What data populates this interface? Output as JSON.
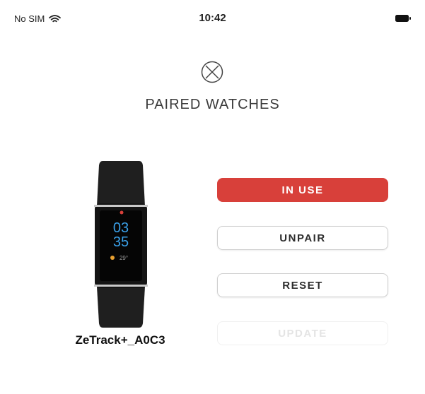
{
  "status_bar": {
    "carrier": "No SIM",
    "time": "10:42"
  },
  "header": {
    "title": "PAIRED WATCHES"
  },
  "device": {
    "name": "ZeTrack+_A0C3",
    "screen_hour": "03",
    "screen_minute": "35",
    "screen_temp": "29°"
  },
  "actions": {
    "in_use_label": "IN USE",
    "unpair_label": "UNPAIR",
    "reset_label": "RESET",
    "update_label": "UPDATE"
  },
  "colors": {
    "accent": "#d8403a",
    "text": "#2b2b2b",
    "border": "#cfcfcf"
  },
  "icons": [
    "wifi-icon",
    "battery-icon",
    "close-icon"
  ]
}
